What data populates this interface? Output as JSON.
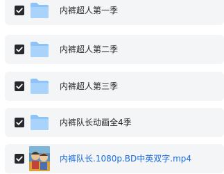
{
  "files": [
    {
      "name": "内裤超人第一季",
      "type": "folder",
      "checked": true,
      "icon": "folder-icon"
    },
    {
      "name": "内裤超人第二季",
      "type": "folder",
      "checked": true,
      "icon": "folder-icon"
    },
    {
      "name": "内裤超人第三季",
      "type": "folder",
      "checked": true,
      "icon": "folder-icon"
    },
    {
      "name": "内裤队长动画全4季",
      "type": "folder",
      "checked": true,
      "icon": "folder-icon"
    },
    {
      "name": "内裤队长.1080p.BD中英双字.mp4",
      "type": "video",
      "checked": true,
      "icon": "video-thumbnail"
    }
  ],
  "colors": {
    "row_background": "#f4f5f6",
    "checkbox": "#26292e",
    "folder": "#8cc4f8",
    "video_link": "#1a6ce0",
    "text": "#1f2328"
  }
}
